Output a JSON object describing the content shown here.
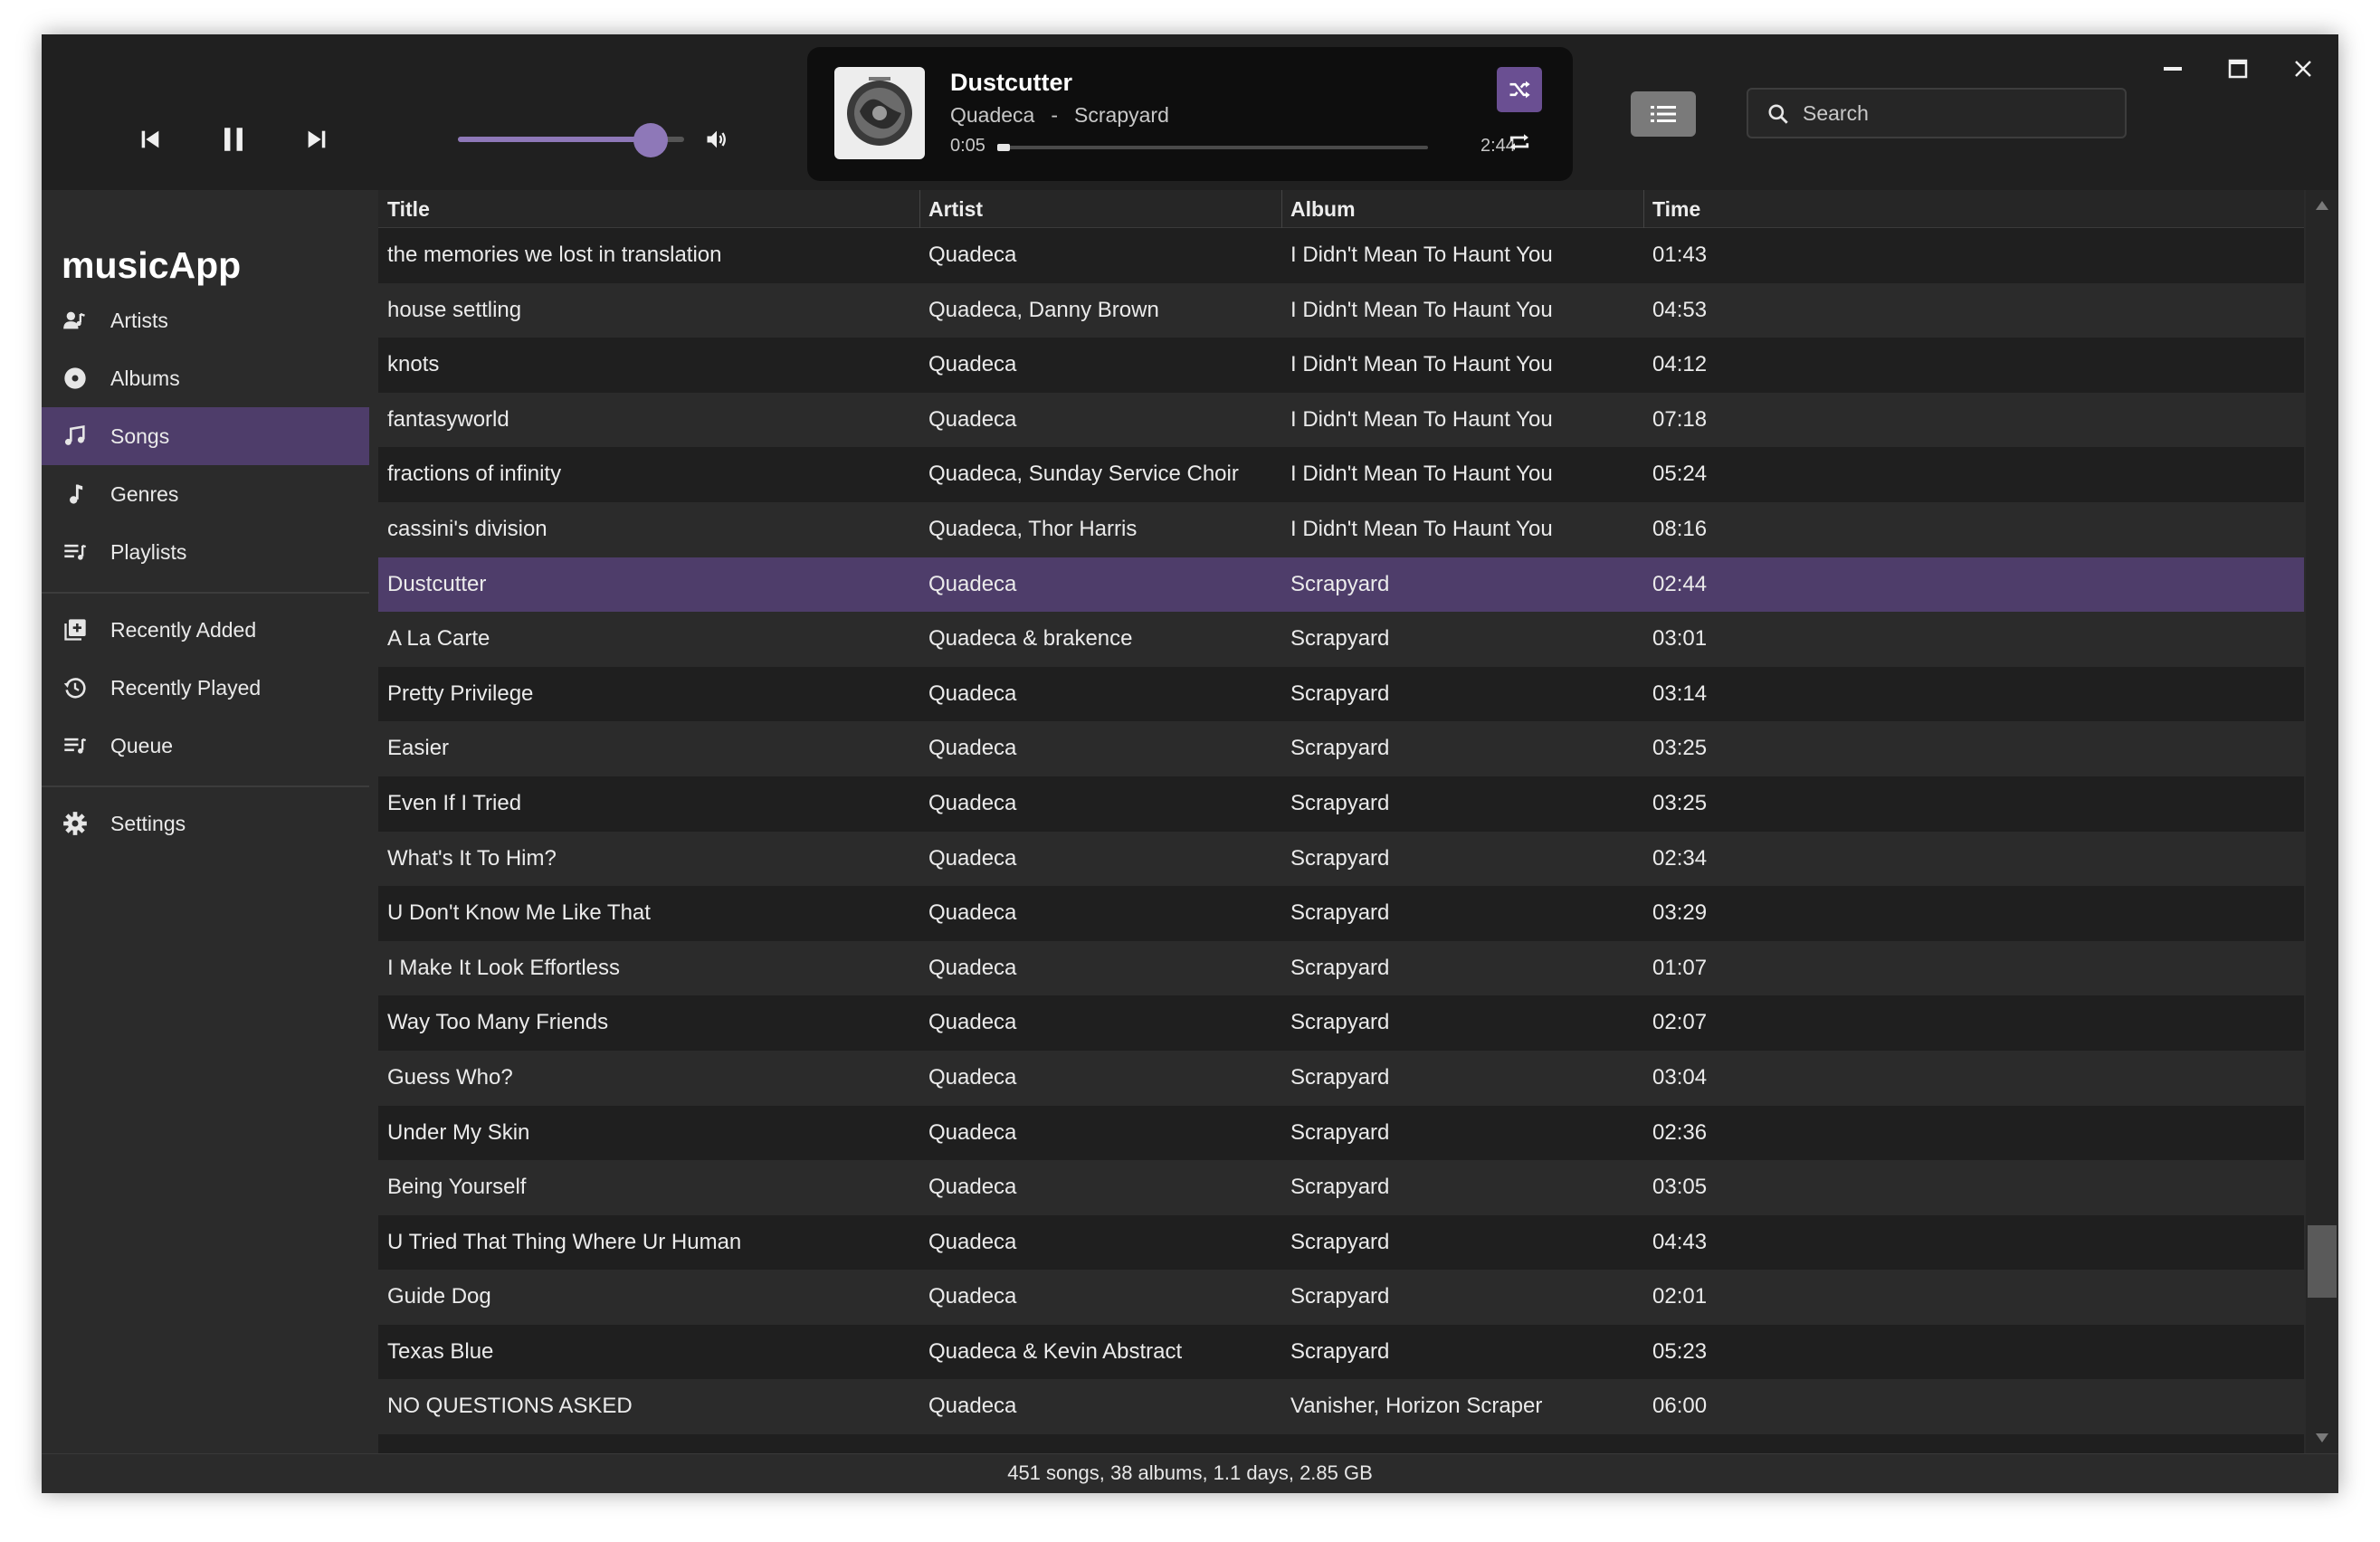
{
  "app": {
    "name": "musicApp"
  },
  "player": {
    "volume": 0.85,
    "now_playing": {
      "title": "Dustcutter",
      "artist": "Quadeca",
      "separator": "-",
      "album": "Scrapyard",
      "elapsed": "0:05",
      "duration": "2:44",
      "progress": 0.03
    },
    "shuffle_on": true
  },
  "search": {
    "placeholder": "Search",
    "value": ""
  },
  "sidebar": {
    "items": [
      {
        "label": "Artists",
        "icon": "artists-icon",
        "active": false
      },
      {
        "label": "Albums",
        "icon": "album-icon",
        "active": false
      },
      {
        "label": "Songs",
        "icon": "songs-icon",
        "active": true
      },
      {
        "label": "Genres",
        "icon": "genres-icon",
        "active": false
      },
      {
        "label": "Playlists",
        "icon": "playlist-icon",
        "active": false
      },
      {
        "label": "Recently Added",
        "icon": "recently-added-icon",
        "active": false
      },
      {
        "label": "Recently Played",
        "icon": "history-icon",
        "active": false
      },
      {
        "label": "Queue",
        "icon": "queue-icon",
        "active": false
      },
      {
        "label": "Settings",
        "icon": "gear-icon",
        "active": false
      }
    ]
  },
  "table": {
    "columns": [
      "Title",
      "Artist",
      "Album",
      "Time"
    ],
    "rows": [
      {
        "title": "the memories we lost in translation",
        "artist": "Quadeca",
        "album": "I Didn't Mean To Haunt You",
        "time": "01:43"
      },
      {
        "title": "house settling",
        "artist": "Quadeca, Danny Brown",
        "album": "I Didn't Mean To Haunt You",
        "time": "04:53"
      },
      {
        "title": "knots",
        "artist": "Quadeca",
        "album": "I Didn't Mean To Haunt You",
        "time": "04:12"
      },
      {
        "title": "fantasyworld",
        "artist": "Quadeca",
        "album": "I Didn't Mean To Haunt You",
        "time": "07:18"
      },
      {
        "title": "fractions of infinity",
        "artist": "Quadeca, Sunday Service Choir",
        "album": "I Didn't Mean To Haunt You",
        "time": "05:24"
      },
      {
        "title": "cassini's division",
        "artist": "Quadeca, Thor Harris",
        "album": "I Didn't Mean To Haunt You",
        "time": "08:16"
      },
      {
        "title": "Dustcutter",
        "artist": "Quadeca",
        "album": "Scrapyard",
        "time": "02:44",
        "selected": true
      },
      {
        "title": "A La Carte",
        "artist": "Quadeca & brakence",
        "album": "Scrapyard",
        "time": "03:01"
      },
      {
        "title": "Pretty Privilege",
        "artist": "Quadeca",
        "album": "Scrapyard",
        "time": "03:14"
      },
      {
        "title": "Easier",
        "artist": "Quadeca",
        "album": "Scrapyard",
        "time": "03:25"
      },
      {
        "title": "Even If I Tried",
        "artist": "Quadeca",
        "album": "Scrapyard",
        "time": "03:25"
      },
      {
        "title": "What's It To Him?",
        "artist": "Quadeca",
        "album": "Scrapyard",
        "time": "02:34"
      },
      {
        "title": "U Don't Know Me Like That",
        "artist": "Quadeca",
        "album": "Scrapyard",
        "time": "03:29"
      },
      {
        "title": "I Make It Look Effortless",
        "artist": "Quadeca",
        "album": "Scrapyard",
        "time": "01:07"
      },
      {
        "title": "Way Too Many Friends",
        "artist": "Quadeca",
        "album": "Scrapyard",
        "time": "02:07"
      },
      {
        "title": "Guess Who?",
        "artist": "Quadeca",
        "album": "Scrapyard",
        "time": "03:04"
      },
      {
        "title": "Under My Skin",
        "artist": "Quadeca",
        "album": "Scrapyard",
        "time": "02:36"
      },
      {
        "title": "Being Yourself",
        "artist": "Quadeca",
        "album": "Scrapyard",
        "time": "03:05"
      },
      {
        "title": "U Tried That Thing Where Ur Human",
        "artist": "Quadeca",
        "album": "Scrapyard",
        "time": "04:43"
      },
      {
        "title": "Guide Dog",
        "artist": "Quadeca",
        "album": "Scrapyard",
        "time": "02:01"
      },
      {
        "title": "Texas Blue",
        "artist": "Quadeca & Kevin Abstract",
        "album": "Scrapyard",
        "time": "05:23"
      },
      {
        "title": "NO QUESTIONS ASKED",
        "artist": "Quadeca",
        "album": "Vanisher, Horizon Scraper",
        "time": "06:00"
      }
    ]
  },
  "status": {
    "text": "451 songs, 38 albums, 1.1 days, 2.85 GB"
  },
  "colors": {
    "accent": "#6a4f92",
    "selection": "#4e3d6a",
    "slider": "#8e78b8",
    "background": "#2b2b2b",
    "table_bg": "#1f1f1f"
  }
}
